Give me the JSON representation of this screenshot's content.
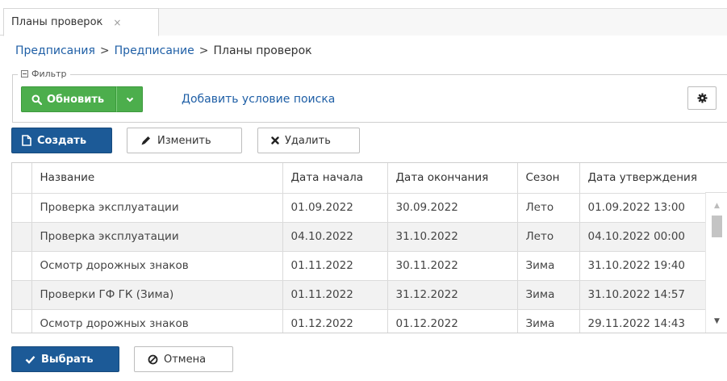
{
  "tab": {
    "label": "Планы проверок",
    "close": "×"
  },
  "breadcrumb": {
    "items": [
      "Предписания",
      "Предписание"
    ],
    "current": "Планы проверок",
    "separator": ">"
  },
  "filter": {
    "legend": "Фильтр",
    "refresh_label": "Обновить",
    "add_condition_label": "Добавить условие поиска"
  },
  "toolbar": {
    "create_label": "Создать",
    "edit_label": "Изменить",
    "delete_label": "Удалить"
  },
  "table": {
    "columns": [
      "Название",
      "Дата начала",
      "Дата окончания",
      "Сезон",
      "Дата утверждения"
    ],
    "rows": [
      [
        "Проверка эксплуатации",
        "01.09.2022",
        "30.09.2022",
        "Лето",
        "01.09.2022 13:00"
      ],
      [
        "Проверка эксплуатации",
        "04.10.2022",
        "31.10.2022",
        "Лето",
        "04.10.2022 00:00"
      ],
      [
        "Осмотр дорожных знаков",
        "01.11.2022",
        "30.11.2022",
        "Зима",
        "31.10.2022 19:40"
      ],
      [
        "Проверки ГФ ГК (Зима)",
        "01.11.2022",
        "31.12.2022",
        "Зима",
        "31.10.2022 14:57"
      ],
      [
        "Осмотр дорожных знаков",
        "01.12.2022",
        "01.12.2022",
        "Зима",
        "29.11.2022 14:43"
      ]
    ]
  },
  "footer": {
    "select_label": "Выбрать",
    "cancel_label": "Отмена"
  },
  "colors": {
    "link": "#1f5fa6",
    "primary": "#1c5a97",
    "success": "#4cae4c"
  }
}
